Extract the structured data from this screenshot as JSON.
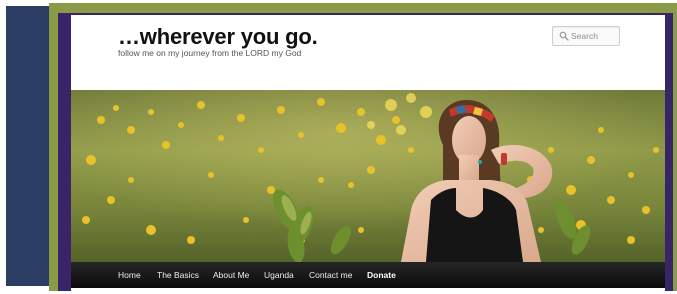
{
  "site": {
    "title": "…wherever you go.",
    "description": "follow me on my journey from the LORD my God"
  },
  "search": {
    "placeholder": "Search",
    "icon": "search-icon"
  },
  "nav": {
    "items": [
      {
        "label": "The Basics"
      },
      {
        "label": "About Me"
      },
      {
        "label": "Uganda"
      },
      {
        "label": "Contact me"
      },
      {
        "label": "Donate"
      }
    ],
    "home_label": "Home"
  },
  "colors": {
    "frame_navy": "#2b3d63",
    "frame_olive": "#8a9a46",
    "frame_purple": "#3a2468",
    "nav_bar": "#141414"
  }
}
